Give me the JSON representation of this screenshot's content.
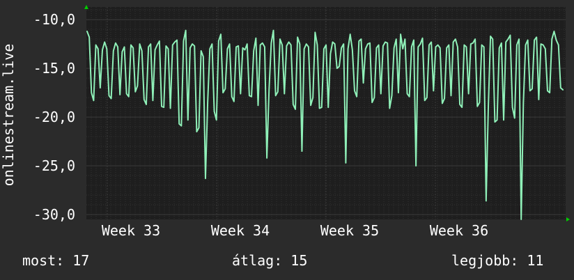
{
  "chart_data": {
    "type": "line",
    "ylabel": "onlinestream.live",
    "ylim": [
      -30.5,
      -8.7
    ],
    "y_ticks": [
      "-10,0",
      "-15,0",
      "-20,0",
      "-25,0",
      "-30,0"
    ],
    "y_tick_values": [
      -10,
      -15,
      -20,
      -25,
      -30
    ],
    "x_tick_labels": [
      "Week 33",
      "Week 34",
      "Week 35",
      "Week 36"
    ],
    "grid": true,
    "colors": {
      "background": "#2b2b2b",
      "plot_background": "#1e1e1e",
      "grid": "#3a3a3a",
      "grid_minor": "#323232",
      "line": "#8ff0b8",
      "axis_arrow": "#00cc00",
      "text": "#ffffff"
    },
    "series": [
      {
        "values": [
          -11.2,
          -11.8,
          -17.5,
          -18.3,
          -12.6,
          -13.0,
          -17.0,
          -13.1,
          -12.3,
          -13.0,
          -17.8,
          -18.1,
          -13.2,
          -12.4,
          -12.8,
          -17.7,
          -13.3,
          -12.8,
          -17.6,
          -17.9,
          -12.6,
          -12.9,
          -17.4,
          -16.8,
          -12.5,
          -13.2,
          -18.2,
          -18.7,
          -12.8,
          -12.5,
          -18.3,
          -13.1,
          -12.6,
          -12.2,
          -18.9,
          -19.0,
          -12.7,
          -13.0,
          -19.1,
          -12.6,
          -12.3,
          -12.1,
          -20.7,
          -20.9,
          -12.2,
          -11.1,
          -20.3,
          -12.9,
          -12.5,
          -12.7,
          -21.5,
          -21.1,
          -13.2,
          -13.8,
          -26.3,
          -18.5,
          -13.0,
          -12.5,
          -19.4,
          -20.3,
          -12.2,
          -11.5,
          -17.5,
          -17.1,
          -13.0,
          -12.5,
          -17.9,
          -18.4,
          -12.8,
          -12.7,
          -17.6,
          -12.9,
          -13.1,
          -12.5,
          -17.8,
          -17.9,
          -13.2,
          -11.9,
          -18.8,
          -12.6,
          -12.4,
          -12.8,
          -24.2,
          -17.2,
          -12.4,
          -11.1,
          -17.8,
          -17.4,
          -12.0,
          -12.6,
          -17.6,
          -12.7,
          -12.3,
          -12.6,
          -18.7,
          -19.2,
          -11.8,
          -12.5,
          -23.5,
          -13.0,
          -12.5,
          -12.8,
          -18.8,
          -18.0,
          -11.3,
          -12.6,
          -19.1,
          -19.0,
          -13.0,
          -12.6,
          -19.0,
          -13.5,
          -12.3,
          -12.5,
          -15.0,
          -14.8,
          -12.9,
          -12.5,
          -24.7,
          -13.0,
          -11.5,
          -13.1,
          -17.3,
          -17.9,
          -12.2,
          -12.0,
          -16.5,
          -13.0,
          -12.5,
          -12.4,
          -18.5,
          -18.0,
          -12.9,
          -12.6,
          -17.6,
          -12.7,
          -12.3,
          -12.4,
          -19.1,
          -17.8,
          -12.9,
          -12.0,
          -17.5,
          -11.5,
          -13.0,
          -12.0,
          -17.6,
          -17.9,
          -12.8,
          -12.1,
          -25.0,
          -12.8,
          -12.5,
          -11.9,
          -18.3,
          -18.0,
          -12.6,
          -12.3,
          -17.3,
          -12.8,
          -12.6,
          -12.9,
          -18.6,
          -18.1,
          -12.9,
          -12.6,
          -17.8,
          -12.3,
          -12.0,
          -12.8,
          -18.7,
          -19.0,
          -12.6,
          -12.8,
          -17.6,
          -12.5,
          -12.4,
          -12.0,
          -18.9,
          -18.5,
          -12.6,
          -12.8,
          -28.6,
          -19.0,
          -11.7,
          -12.0,
          -20.5,
          -20.3,
          -12.9,
          -12.4,
          -20.3,
          -12.3,
          -12.0,
          -11.6,
          -19.0,
          -20.1,
          -12.6,
          -12.0,
          -30.5,
          -18.5,
          -12.6,
          -12.1,
          -17.3,
          -17.1,
          -12.1,
          -11.8,
          -18.2,
          -12.5,
          -12.6,
          -13.0,
          -17.3,
          -17.5,
          -12.0,
          -11.2,
          -12.1,
          -12.6,
          -17.0,
          -17.2
        ]
      }
    ]
  },
  "footer": {
    "current": "most: 17",
    "average": "átlag: 15",
    "best": "legjobb: 11"
  }
}
